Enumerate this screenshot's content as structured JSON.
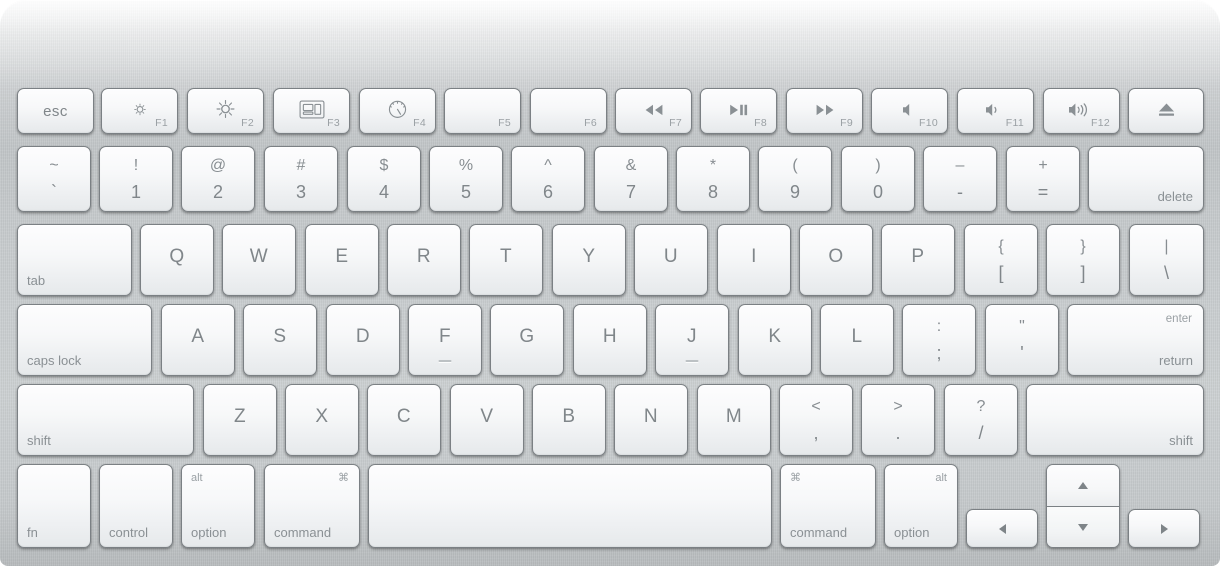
{
  "device": {
    "name": "Apple Wireless Keyboard",
    "layout": "US English",
    "body_color": "#c7cbcd",
    "key_color": "#f6f8f9",
    "legend_color": "#8a9094"
  },
  "rows": [
    {
      "name": "function-row",
      "keys": [
        {
          "name": "esc",
          "center": "esc"
        },
        {
          "name": "f1",
          "fn": "F1",
          "icon": "brightness-down-icon"
        },
        {
          "name": "f2",
          "fn": "F2",
          "icon": "brightness-up-icon"
        },
        {
          "name": "f3",
          "fn": "F3",
          "icon": "mission-control-icon"
        },
        {
          "name": "f4",
          "fn": "F4",
          "icon": "dashboard-icon"
        },
        {
          "name": "f5",
          "fn": "F5",
          "icon": ""
        },
        {
          "name": "f6",
          "fn": "F6",
          "icon": ""
        },
        {
          "name": "f7",
          "fn": "F7",
          "icon": "rewind-icon"
        },
        {
          "name": "f8",
          "fn": "F8",
          "icon": "play-pause-icon"
        },
        {
          "name": "f9",
          "fn": "F9",
          "icon": "fast-forward-icon"
        },
        {
          "name": "f10",
          "fn": "F10",
          "icon": "mute-icon"
        },
        {
          "name": "f11",
          "fn": "F11",
          "icon": "volume-down-icon"
        },
        {
          "name": "f12",
          "fn": "F12",
          "icon": "volume-up-icon"
        },
        {
          "name": "eject",
          "fn": "",
          "icon": "eject-icon"
        }
      ]
    },
    {
      "name": "number-row",
      "keys": [
        {
          "name": "grave",
          "top": "~",
          "bottom": "`"
        },
        {
          "name": "digit-1",
          "top": "!",
          "bottom": "1"
        },
        {
          "name": "digit-2",
          "top": "@",
          "bottom": "2"
        },
        {
          "name": "digit-3",
          "top": "#",
          "bottom": "3"
        },
        {
          "name": "digit-4",
          "top": "$",
          "bottom": "4"
        },
        {
          "name": "digit-5",
          "top": "%",
          "bottom": "5"
        },
        {
          "name": "digit-6",
          "top": "^",
          "bottom": "6"
        },
        {
          "name": "digit-7",
          "top": "&",
          "bottom": "7"
        },
        {
          "name": "digit-8",
          "top": "*",
          "bottom": "8"
        },
        {
          "name": "digit-9",
          "top": "(",
          "bottom": "9"
        },
        {
          "name": "digit-0",
          "top": ")",
          "bottom": "0"
        },
        {
          "name": "minus",
          "top": "–",
          "bottom": "-"
        },
        {
          "name": "equals",
          "top": "+",
          "bottom": "="
        },
        {
          "name": "delete",
          "corner_br": "delete"
        }
      ]
    },
    {
      "name": "tab-row",
      "keys": [
        {
          "name": "tab",
          "corner_bl": "tab"
        },
        {
          "name": "key-q",
          "center": "Q"
        },
        {
          "name": "key-w",
          "center": "W"
        },
        {
          "name": "key-e",
          "center": "E"
        },
        {
          "name": "key-r",
          "center": "R"
        },
        {
          "name": "key-t",
          "center": "T"
        },
        {
          "name": "key-y",
          "center": "Y"
        },
        {
          "name": "key-u",
          "center": "U"
        },
        {
          "name": "key-i",
          "center": "I"
        },
        {
          "name": "key-o",
          "center": "O"
        },
        {
          "name": "key-p",
          "center": "P"
        },
        {
          "name": "bracket-left",
          "top": "{",
          "bottom": "["
        },
        {
          "name": "bracket-right",
          "top": "}",
          "bottom": "]"
        },
        {
          "name": "backslash",
          "top": "|",
          "bottom": "\\"
        }
      ]
    },
    {
      "name": "home-row",
      "keys": [
        {
          "name": "caps-lock",
          "corner_bl": "caps lock"
        },
        {
          "name": "key-a",
          "center": "A"
        },
        {
          "name": "key-s",
          "center": "S"
        },
        {
          "name": "key-d",
          "center": "D"
        },
        {
          "name": "key-f",
          "center": "F",
          "bump": true
        },
        {
          "name": "key-g",
          "center": "G"
        },
        {
          "name": "key-h",
          "center": "H"
        },
        {
          "name": "key-j",
          "center": "J",
          "bump": true
        },
        {
          "name": "key-k",
          "center": "K"
        },
        {
          "name": "key-l",
          "center": "L"
        },
        {
          "name": "semicolon",
          "top": ":",
          "bottom": ";"
        },
        {
          "name": "quote",
          "top": "\"",
          "bottom": "'"
        },
        {
          "name": "return",
          "corner_tr_sm": "enter",
          "corner_br": "return"
        }
      ]
    },
    {
      "name": "shift-row",
      "keys": [
        {
          "name": "shift-left",
          "corner_bl": "shift"
        },
        {
          "name": "key-z",
          "center": "Z"
        },
        {
          "name": "key-x",
          "center": "X"
        },
        {
          "name": "key-c",
          "center": "C"
        },
        {
          "name": "key-v",
          "center": "V"
        },
        {
          "name": "key-b",
          "center": "B"
        },
        {
          "name": "key-n",
          "center": "N"
        },
        {
          "name": "key-m",
          "center": "M"
        },
        {
          "name": "comma",
          "top": "<",
          "bottom": ","
        },
        {
          "name": "period",
          "top": ">",
          "bottom": "."
        },
        {
          "name": "slash",
          "top": "?",
          "bottom": "/"
        },
        {
          "name": "shift-right",
          "corner_br": "shift"
        }
      ]
    },
    {
      "name": "modifier-row",
      "keys": [
        {
          "name": "fn",
          "corner_bl": "fn"
        },
        {
          "name": "control",
          "corner_bl": "control"
        },
        {
          "name": "option-left",
          "corner_tl": "alt",
          "corner_bl": "option"
        },
        {
          "name": "command-left",
          "corner_tr": "⌘",
          "corner_bl": "command"
        },
        {
          "name": "space",
          "center": ""
        },
        {
          "name": "command-right",
          "corner_tl": "⌘",
          "corner_bl": "command"
        },
        {
          "name": "option-right",
          "corner_tr": "alt",
          "corner_bl": "option"
        },
        {
          "name": "arrow-left",
          "icon": "arrow-left-icon"
        },
        {
          "name": "arrow-up-down",
          "icon": "arrow-up-down-icon"
        },
        {
          "name": "arrow-right",
          "icon": "arrow-right-icon"
        }
      ]
    }
  ]
}
